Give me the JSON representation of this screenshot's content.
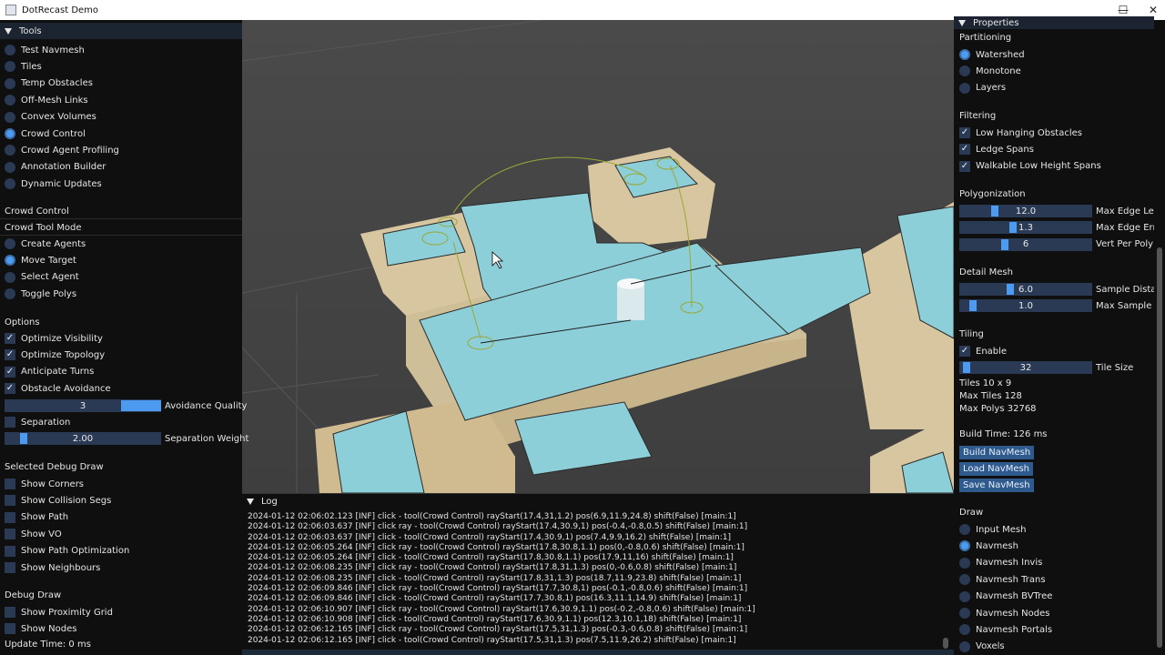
{
  "window": {
    "title": "DotRecast Demo",
    "minimize": "—",
    "maximize": "☐",
    "close": "✕"
  },
  "left": {
    "tools_header": "Tools",
    "tools": [
      {
        "label": "Test Navmesh",
        "selected": false
      },
      {
        "label": "Tiles",
        "selected": false
      },
      {
        "label": "Temp Obstacles",
        "selected": false
      },
      {
        "label": "Off-Mesh Links",
        "selected": false
      },
      {
        "label": "Convex Volumes",
        "selected": false
      },
      {
        "label": "Crowd Control",
        "selected": true
      },
      {
        "label": "Crowd Agent Profiling",
        "selected": false
      },
      {
        "label": "Annotation Builder",
        "selected": false
      },
      {
        "label": "Dynamic Updates",
        "selected": false
      }
    ],
    "crowd_control_title": "Crowd Control",
    "crowd_tool_mode_title": "Crowd Tool Mode",
    "modes": [
      {
        "label": "Create Agents",
        "selected": false
      },
      {
        "label": "Move Target",
        "selected": true
      },
      {
        "label": "Select Agent",
        "selected": false
      },
      {
        "label": "Toggle Polys",
        "selected": false
      }
    ],
    "options_title": "Options",
    "options": [
      {
        "label": "Optimize Visibility",
        "checked": true
      },
      {
        "label": "Optimize Topology",
        "checked": true
      },
      {
        "label": "Anticipate Turns",
        "checked": true
      },
      {
        "label": "Obstacle Avoidance",
        "checked": true
      }
    ],
    "avoidance_quality": {
      "value": "3",
      "label": "Avoidance Quality",
      "fraction": 1.0
    },
    "separation": {
      "label": "Separation",
      "checked": false
    },
    "separation_weight": {
      "value": "2.00",
      "label": "Separation Weight",
      "fraction": 0.1
    },
    "debug_title": "Selected Debug Draw",
    "debug_items": [
      {
        "label": "Show Corners",
        "checked": false
      },
      {
        "label": "Show Collision Segs",
        "checked": false
      },
      {
        "label": "Show Path",
        "checked": false
      },
      {
        "label": "Show VO",
        "checked": false
      },
      {
        "label": "Show Path Optimization",
        "checked": false
      },
      {
        "label": "Show Neighbours",
        "checked": false
      }
    ],
    "debug_draw_title": "Debug Draw",
    "debug_draw_items": [
      {
        "label": "Show Proximity Grid",
        "checked": false
      },
      {
        "label": "Show Nodes",
        "checked": false
      }
    ],
    "update_time": "Update Time: 0 ms"
  },
  "right": {
    "properties_header": "Properties",
    "partitioning_title": "Partitioning",
    "partitioning": [
      {
        "label": "Watershed",
        "selected": true
      },
      {
        "label": "Monotone",
        "selected": false
      },
      {
        "label": "Layers",
        "selected": false
      }
    ],
    "filtering_title": "Filtering",
    "filtering": [
      {
        "label": "Low Hanging Obstacles",
        "checked": true
      },
      {
        "label": "Ledge Spans",
        "checked": true
      },
      {
        "label": "Walkable Low Height Spans",
        "checked": true
      }
    ],
    "polygonization_title": "Polygonization",
    "polygonization": [
      {
        "value": "12.0",
        "label": "Max Edge Len",
        "fraction": 0.25
      },
      {
        "value": "1.3",
        "label": "Max Edge Erro",
        "fraction": 0.4
      },
      {
        "value": "6",
        "label": "Vert Per Poly",
        "fraction": 0.33
      }
    ],
    "detail_title": "Detail Mesh",
    "detail": [
      {
        "value": "6.0",
        "label": "Sample Distar",
        "fraction": 0.38
      },
      {
        "value": "1.0",
        "label": "Max Sample E",
        "fraction": 0.08
      }
    ],
    "tiling_title": "Tiling",
    "tiling_enable": {
      "label": "Enable",
      "checked": true
    },
    "tile_size": {
      "value": "32",
      "label": "Tile Size",
      "fraction": 0.03
    },
    "tiles": "Tiles  10 x 9",
    "max_tiles": "Max Tiles  128",
    "max_polys": "Max Polys  32768",
    "build_time": "Build Time: 126 ms",
    "buttons": [
      "Build NavMesh",
      "Load NavMesh",
      "Save NavMesh"
    ],
    "draw_title": "Draw",
    "draw": [
      {
        "label": "Input Mesh",
        "selected": false
      },
      {
        "label": "Navmesh",
        "selected": true
      },
      {
        "label": "Navmesh Invis",
        "selected": false
      },
      {
        "label": "Navmesh Trans",
        "selected": false
      },
      {
        "label": "Navmesh BVTree",
        "selected": false
      },
      {
        "label": "Navmesh Nodes",
        "selected": false
      },
      {
        "label": "Navmesh Portals",
        "selected": false
      },
      {
        "label": "Voxels",
        "selected": false
      }
    ]
  },
  "log": {
    "header": "Log",
    "lines": [
      "2024-01-12 02:06:02.123 [INF] click - tool(Crowd Control) rayStart(17.4,31,1.2) pos(6.9,11.9,24.8) shift(False) [main:1]",
      "2024-01-12 02:06:03.637 [INF] click ray - tool(Crowd Control) rayStart(17.4,30.9,1) pos(-0.4,-0.8,0.5) shift(False) [main:1]",
      "2024-01-12 02:06:03.637 [INF] click - tool(Crowd Control) rayStart(17.4,30.9,1) pos(7.4,9.9,16.2) shift(False) [main:1]",
      "2024-01-12 02:06:05.264 [INF] click ray - tool(Crowd Control) rayStart(17.8,30.8,1.1) pos(0,-0.8,0.6) shift(False) [main:1]",
      "2024-01-12 02:06:05.264 [INF] click - tool(Crowd Control) rayStart(17.8,30.8,1.1) pos(17.9,11,16) shift(False) [main:1]",
      "2024-01-12 02:06:08.235 [INF] click ray - tool(Crowd Control) rayStart(17.8,31,1.3) pos(0,-0.6,0.8) shift(False) [main:1]",
      "2024-01-12 02:06:08.235 [INF] click - tool(Crowd Control) rayStart(17.8,31,1.3) pos(18.7,11.9,23.8) shift(False) [main:1]",
      "2024-01-12 02:06:09.846 [INF] click ray - tool(Crowd Control) rayStart(17.7,30.8,1) pos(-0.1,-0.8,0.6) shift(False) [main:1]",
      "2024-01-12 02:06:09.846 [INF] click - tool(Crowd Control) rayStart(17.7,30.8,1) pos(16.3,11.1,14.9) shift(False) [main:1]",
      "2024-01-12 02:06:10.907 [INF] click ray - tool(Crowd Control) rayStart(17.6,30.9,1.1) pos(-0.2,-0.8,0.6) shift(False) [main:1]",
      "2024-01-12 02:06:10.908 [INF] click - tool(Crowd Control) rayStart(17.6,30.9,1.1) pos(12.3,10.1,18) shift(False) [main:1]",
      "2024-01-12 02:06:12.165 [INF] click ray - tool(Crowd Control) rayStart(17.5,31,1.3) pos(-0.3,-0.6,0.8) shift(False) [main:1]",
      "2024-01-12 02:06:12.165 [INF] click - tool(Crowd Control) rayStart(17.5,31,1.3) pos(7.5,11.9,26.2) shift(False) [main:1]"
    ]
  }
}
